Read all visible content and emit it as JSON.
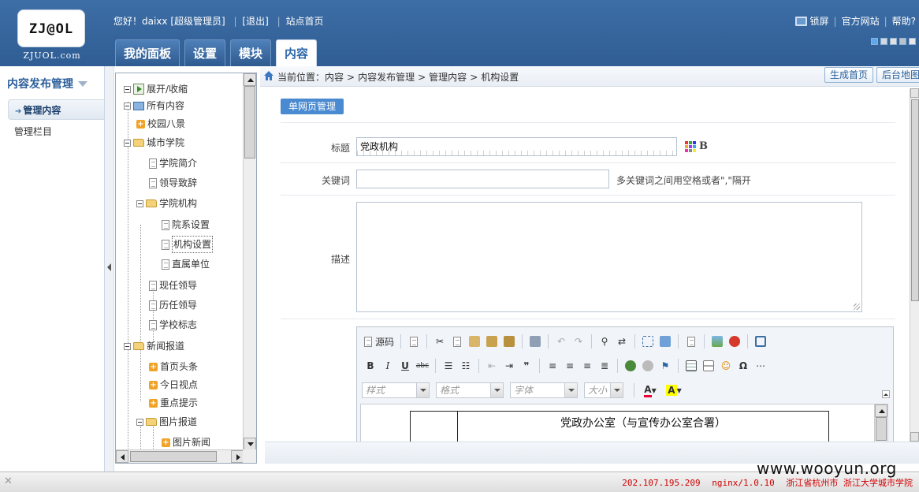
{
  "header": {
    "logo_text": "ZJ@OL",
    "logo_sub": "ZJUOL.com",
    "greeting": "您好！daixx [超级管理员]",
    "logout": "[退出]",
    "site_home": "站点首页",
    "lock_screen": "锁屏",
    "official_site": "官方网站",
    "help": "帮助?",
    "skin_colors": [
      "#5fa7e6",
      "#cfd8e3",
      "#e1e1e1",
      "#b9c3cc",
      "#e8e8e8"
    ],
    "tabs": [
      {
        "label": "我的面板",
        "active": false
      },
      {
        "label": "设置",
        "active": false
      },
      {
        "label": "模块",
        "active": false
      },
      {
        "label": "内容",
        "active": true
      }
    ]
  },
  "leftnav": {
    "title": "内容发布管理",
    "items": [
      {
        "label": "管理内容",
        "active": true
      },
      {
        "label": "管理栏目",
        "active": false
      }
    ]
  },
  "tree": {
    "toggle_label": "展开/收缩",
    "all_content": "所有内容",
    "nodes": [
      {
        "label": "校园八景"
      },
      {
        "label": "城市学院"
      },
      {
        "label": "学院简介"
      },
      {
        "label": "领导致辞"
      },
      {
        "label": "学院机构"
      },
      {
        "label": "院系设置"
      },
      {
        "label": "机构设置"
      },
      {
        "label": "直属单位"
      },
      {
        "label": "现任领导"
      },
      {
        "label": "历任领导"
      },
      {
        "label": "学校标志"
      },
      {
        "label": "新闻报道"
      },
      {
        "label": "首页头条"
      },
      {
        "label": "今日视点"
      },
      {
        "label": "重点提示"
      },
      {
        "label": "图片报道"
      },
      {
        "label": "图片新闻"
      }
    ]
  },
  "breadcrumb": {
    "prefix": "当前位置：",
    "parts": [
      "内容",
      "内容发布管理",
      "管理内容",
      "机构设置"
    ],
    "sep": ">",
    "btn_generate": "生成首页",
    "btn_backend_map": "后台地图"
  },
  "form": {
    "section_tab": "单网页管理",
    "title_label": "标题",
    "title_value": "党政机构",
    "keywords_label": "关键词",
    "keywords_value": "",
    "keywords_hint": "多关键词之间用空格或者\",\"隔开",
    "desc_label": "描述",
    "desc_value": ""
  },
  "editor": {
    "source_label": "源码",
    "combos": {
      "style": "样式",
      "format": "格式",
      "font": "字体",
      "size": "大小"
    },
    "content_heading": "党政办公室（与宣传办公室合署）"
  },
  "status": {
    "ip": "202.107.195.209",
    "server": "nginx/1.0.10",
    "location": "浙江省杭州市 浙江大学城市学院"
  },
  "watermark": "www.wooyun.org"
}
